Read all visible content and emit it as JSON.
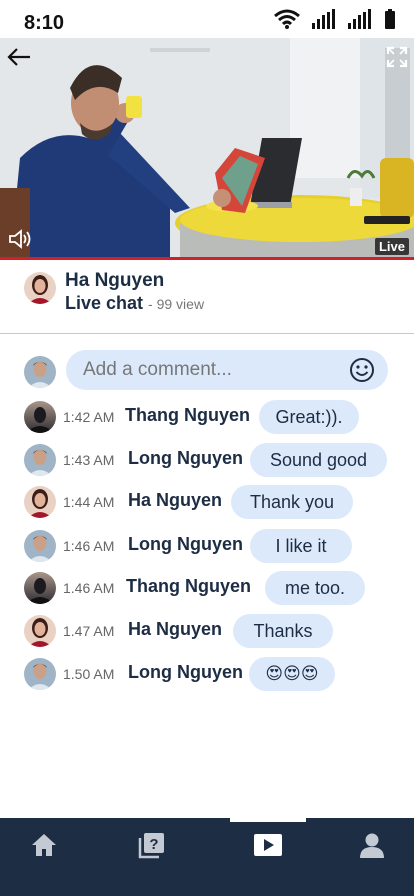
{
  "status_bar": {
    "time": "8:10"
  },
  "video": {
    "live_label": "Live"
  },
  "channel": {
    "name": "Ha Nguyen",
    "subtitle": "Live chat",
    "views": "- 99 view"
  },
  "comment_input": {
    "placeholder": "Add a comment..."
  },
  "messages": [
    {
      "time": "1:42 AM",
      "name": "Thang Nguyen",
      "text": "Great:))."
    },
    {
      "time": "1:43 AM",
      "name": "Long Nguyen",
      "text": "Sound good"
    },
    {
      "time": "1:44 AM",
      "name": "Ha Nguyen",
      "text": "Thank you"
    },
    {
      "time": "1:46 AM",
      "name": "Long Nguyen",
      "text": "I like it"
    },
    {
      "time": "1.46 AM",
      "name": "Thang Nguyen",
      "text": "me too."
    },
    {
      "time": "1.47 AM",
      "name": "Ha Nguyen",
      "text": "Thanks"
    },
    {
      "time": "1.50 AM",
      "name": "Long Nguyen",
      "text": "😍😍😍"
    }
  ],
  "colors": {
    "accent": "#1d2d44",
    "bubble": "#dbe9fb",
    "live_line": "#d0202a"
  },
  "bottom_nav": {
    "items": [
      {
        "icon": "home-icon"
      },
      {
        "icon": "question-book-icon"
      },
      {
        "icon": "play-icon",
        "active": true
      },
      {
        "icon": "profile-icon"
      }
    ]
  }
}
